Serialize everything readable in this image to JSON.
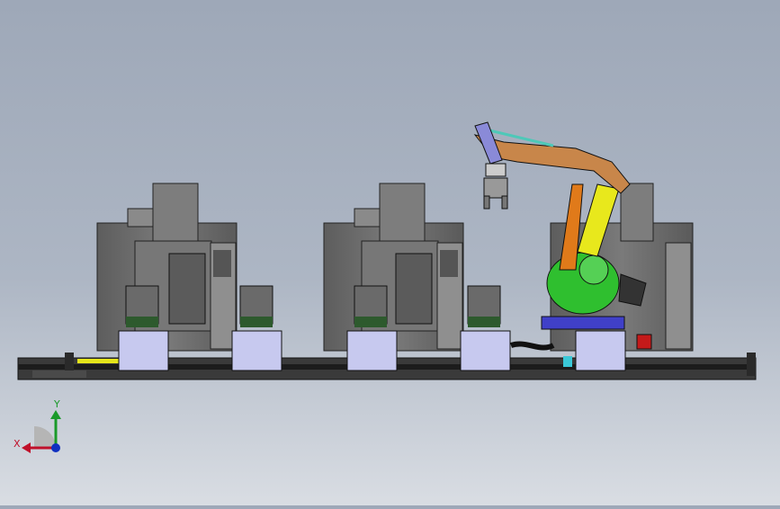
{
  "scene": {
    "description_type": "cad-assembly-viewport",
    "view": "front"
  },
  "triad": {
    "x_label": "X",
    "y_label": "Y",
    "colors": {
      "x": "#c0102a",
      "y": "#1a9a2a",
      "z": "#1030c0"
    }
  },
  "colors": {
    "machine_body": "#6a6a6a",
    "machine_panel": "#8a8a8a",
    "rail": "#2a2a2a",
    "robot_orange": "#e07a1a",
    "robot_green": "#2fbf2f",
    "robot_yellow": "#e8e81c",
    "robot_arm": "#c8864a",
    "stand_blue": "#c7c9ef",
    "base_blue": "#4040c8"
  }
}
